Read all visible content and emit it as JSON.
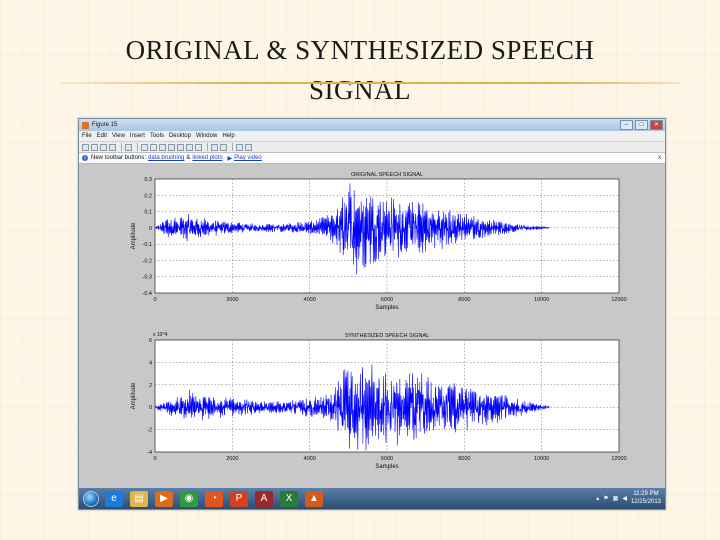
{
  "slide": {
    "title_line1": "ORIGINAL & SYNTHESIZED SPEECH",
    "title_line2": "SIGNAL"
  },
  "window": {
    "title": "Figure 15",
    "controls": [
      "–",
      "□",
      "✕"
    ],
    "menu": [
      "File",
      "Edit",
      "View",
      "Insert",
      "Tools",
      "Desktop",
      "Window",
      "Help"
    ],
    "toolbar_icons": [
      "new-figure-icon",
      "open-icon",
      "save-icon",
      "print-icon",
      "arrow-icon",
      "zoom-in-icon",
      "zoom-out-icon",
      "pan-icon",
      "rotate-icon",
      "data-cursor-icon",
      "brush-icon",
      "link-icon",
      "colorbar-icon",
      "legend-icon",
      "hide-plot-tools-icon",
      "show-plot-tools-icon"
    ],
    "info": {
      "text_before": "New toolbar buttons:",
      "link1": "data brushing",
      "text_mid": "&",
      "link2": "linked plots",
      "link3": "Play video",
      "close": "x"
    }
  },
  "chart_data": [
    {
      "type": "line",
      "title": "ORIGINAL SPEECH SIGNAL",
      "xlabel": "Samples",
      "ylabel": "Amplitude",
      "xlim": [
        0,
        12000
      ],
      "ylim": [
        -0.4,
        0.3
      ],
      "x_ticks": [
        "0",
        "2000",
        "4000",
        "6000",
        "8000",
        "10000",
        "12000"
      ],
      "y_ticks": [
        "0.3",
        "0.2",
        "0.1",
        "0",
        "-0.1",
        "-0.2",
        "-0.3",
        "-0.4"
      ],
      "grid": true,
      "color": "#0000ff",
      "envelope": [
        [
          0,
          0.002
        ],
        [
          300,
          0.05
        ],
        [
          800,
          0.07
        ],
        [
          1500,
          0.04
        ],
        [
          2000,
          0.03
        ],
        [
          2800,
          0.02
        ],
        [
          3500,
          0.025
        ],
        [
          4200,
          0.04
        ],
        [
          4700,
          0.09
        ],
        [
          5000,
          0.25
        ],
        [
          5300,
          0.22
        ],
        [
          5600,
          0.18
        ],
        [
          6000,
          0.16
        ],
        [
          6500,
          0.14
        ],
        [
          7000,
          0.12
        ],
        [
          7500,
          0.1
        ],
        [
          8000,
          0.07
        ],
        [
          8500,
          0.05
        ],
        [
          9200,
          0.025
        ],
        [
          10000,
          0.008
        ],
        [
          10200,
          0.003
        ]
      ]
    },
    {
      "type": "line",
      "title": "SYNTHESIZED SPEECH SIGNAL",
      "xlabel": "Samples",
      "ylabel": "Amplitude",
      "y_multiplier": "x 10^4",
      "xlim": [
        0,
        12000
      ],
      "ylim": [
        -4,
        6
      ],
      "x_ticks": [
        "0",
        "2000",
        "4000",
        "6000",
        "8000",
        "10000",
        "12000"
      ],
      "y_ticks": [
        "6",
        "4",
        "2",
        "0",
        "-2",
        "-4"
      ],
      "grid": true,
      "color": "#0000ff",
      "envelope": [
        [
          0,
          0.1
        ],
        [
          400,
          0.6
        ],
        [
          900,
          1.2
        ],
        [
          1500,
          0.8
        ],
        [
          2200,
          0.6
        ],
        [
          3000,
          0.4
        ],
        [
          3800,
          0.6
        ],
        [
          4500,
          0.9
        ],
        [
          5000,
          3.5
        ],
        [
          5400,
          3.3
        ],
        [
          5800,
          3.0
        ],
        [
          6300,
          2.8
        ],
        [
          6800,
          2.4
        ],
        [
          7300,
          2.2
        ],
        [
          7800,
          1.8
        ],
        [
          8400,
          1.4
        ],
        [
          9000,
          1.0
        ],
        [
          9600,
          0.5
        ],
        [
          10000,
          0.2
        ],
        [
          10200,
          0.1
        ]
      ]
    }
  ],
  "taskbar": {
    "apps": [
      {
        "name": "start-orb-icon"
      },
      {
        "name": "internet-explorer-icon",
        "glyph": "e",
        "color": "#1d7ad8"
      },
      {
        "name": "file-explorer-icon",
        "glyph": "▤",
        "color": "#e3b44a"
      },
      {
        "name": "media-player-icon",
        "glyph": "▶",
        "color": "#e06a1c"
      },
      {
        "name": "chrome-icon",
        "glyph": "◉",
        "color": "#2f9b3d"
      },
      {
        "name": "firefox-icon",
        "glyph": "◔",
        "color": "#e0561c"
      },
      {
        "name": "powerpoint-icon",
        "glyph": "P",
        "color": "#d2421f"
      },
      {
        "name": "access-icon",
        "glyph": "A",
        "color": "#9b2a2a"
      },
      {
        "name": "excel-icon",
        "glyph": "X",
        "color": "#2a7a3a"
      },
      {
        "name": "matlab-icon",
        "glyph": "▲",
        "color": "#d85a1a"
      }
    ],
    "clock_time": "11:29 PM",
    "clock_date": "12/25/2013"
  }
}
